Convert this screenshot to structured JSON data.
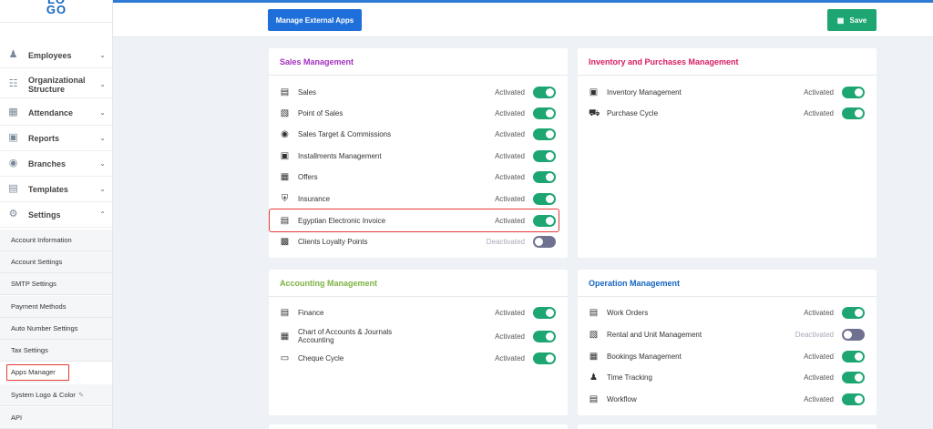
{
  "logo": {
    "line1": "LO",
    "line2": "GO"
  },
  "nav": {
    "employees": "Employees",
    "org": "Organizational Structure",
    "attendance": "Attendance",
    "reports": "Reports",
    "branches": "Branches",
    "templates": "Templates",
    "settings": "Settings"
  },
  "settings_sub": {
    "account_info": "Account Information",
    "account_settings": "Account Settings",
    "smtp": "SMTP Settings",
    "payment": "Payment Methods",
    "auto_number": "Auto Number Settings",
    "tax": "Tax Settings",
    "apps_manager": "Apps Manager",
    "system_logo": "System Logo & Color",
    "api": "API"
  },
  "toolbar": {
    "manage_external": "Manage External Apps",
    "save": "Save"
  },
  "status": {
    "on": "Activated",
    "off": "Deactivated"
  },
  "sales": {
    "title": "Sales Management",
    "items": [
      "Sales",
      "Point of Sales",
      "Sales Target & Commissions",
      "Installments Management",
      "Offers",
      "Insurance",
      "Egyptian Electronic Invoice",
      "Clients Loyalty Points"
    ]
  },
  "inventory": {
    "title": "Inventory and Purchases Management",
    "items": [
      "Inventory Management",
      "Purchase Cycle"
    ]
  },
  "accounting": {
    "title": "Accounting Management",
    "items": [
      "Finance",
      "Chart of Accounts & Journals Accounting",
      "Cheque Cycle"
    ]
  },
  "operation": {
    "title": "Operation Management",
    "items": [
      "Work Orders",
      "Rental and Unit Management",
      "Bookings Management",
      "Time Tracking",
      "Workflow"
    ]
  },
  "colors": {
    "accent": "#1e6fd9",
    "success": "#1da672",
    "sales_title": "#a22fbf",
    "inventory_title": "#d81b60",
    "accounting_title": "#7cb342",
    "operation_title": "#1565c0",
    "highlight": "#e53935"
  }
}
